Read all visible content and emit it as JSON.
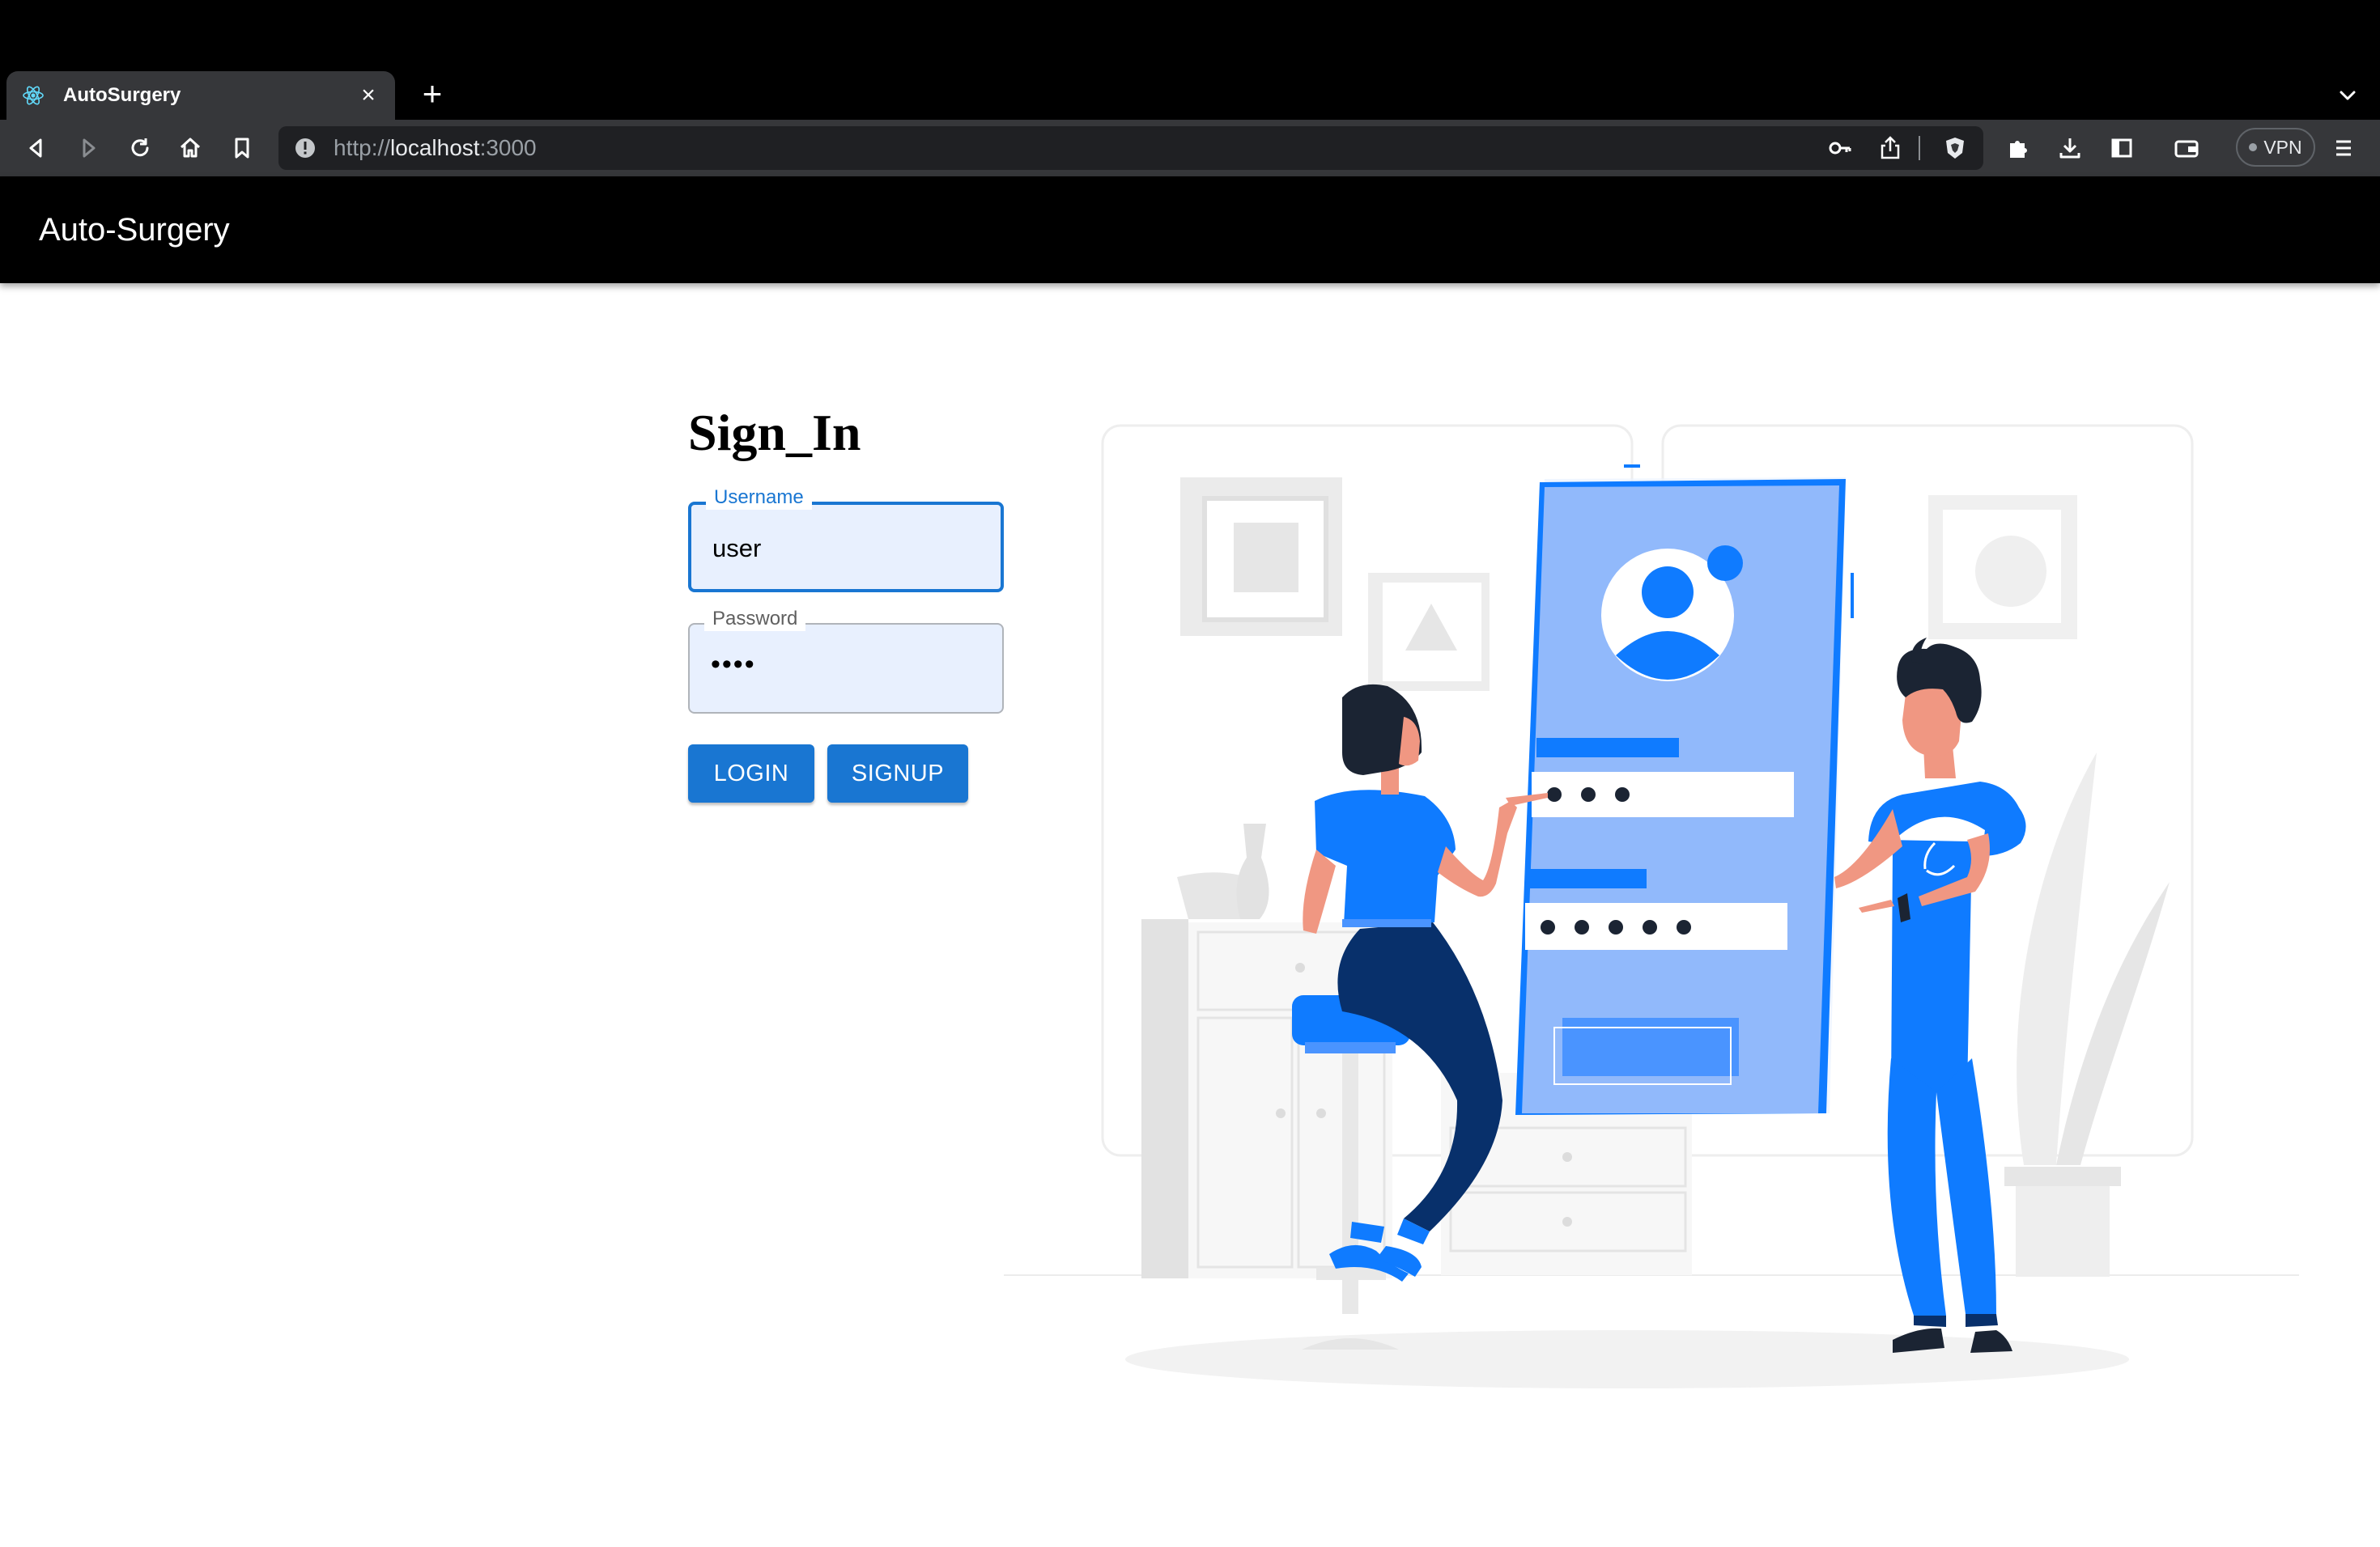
{
  "browser": {
    "tab_title": "AutoSurgery",
    "new_tab": "+",
    "tab_close": "×",
    "url_scheme": "http://",
    "url_host": "localhost",
    "url_port": ":3000",
    "vpn_label": "VPN",
    "icons": [
      "back-icon",
      "forward-icon",
      "reload-icon",
      "home-icon",
      "bookmark-icon",
      "site-info-icon",
      "key-icon",
      "share-icon",
      "brave-shields-icon",
      "extensions-icon",
      "download-icon",
      "sidebar-icon",
      "wallet-icon",
      "menu-icon",
      "tab-list-chevron-icon",
      "react-favicon-icon"
    ]
  },
  "app": {
    "title": "Auto-Surgery"
  },
  "signin": {
    "heading": "Sign_In",
    "username_label": "Username",
    "username_value": "user",
    "password_label": "Password",
    "password_value": "••••",
    "login_label": "LOGIN",
    "signup_label": "SIGNUP"
  },
  "colors": {
    "primary": "#1976d2",
    "field_bg": "#e8f0fe",
    "illustration_blue": "#0f7bff",
    "illustration_navy": "#08306b"
  }
}
